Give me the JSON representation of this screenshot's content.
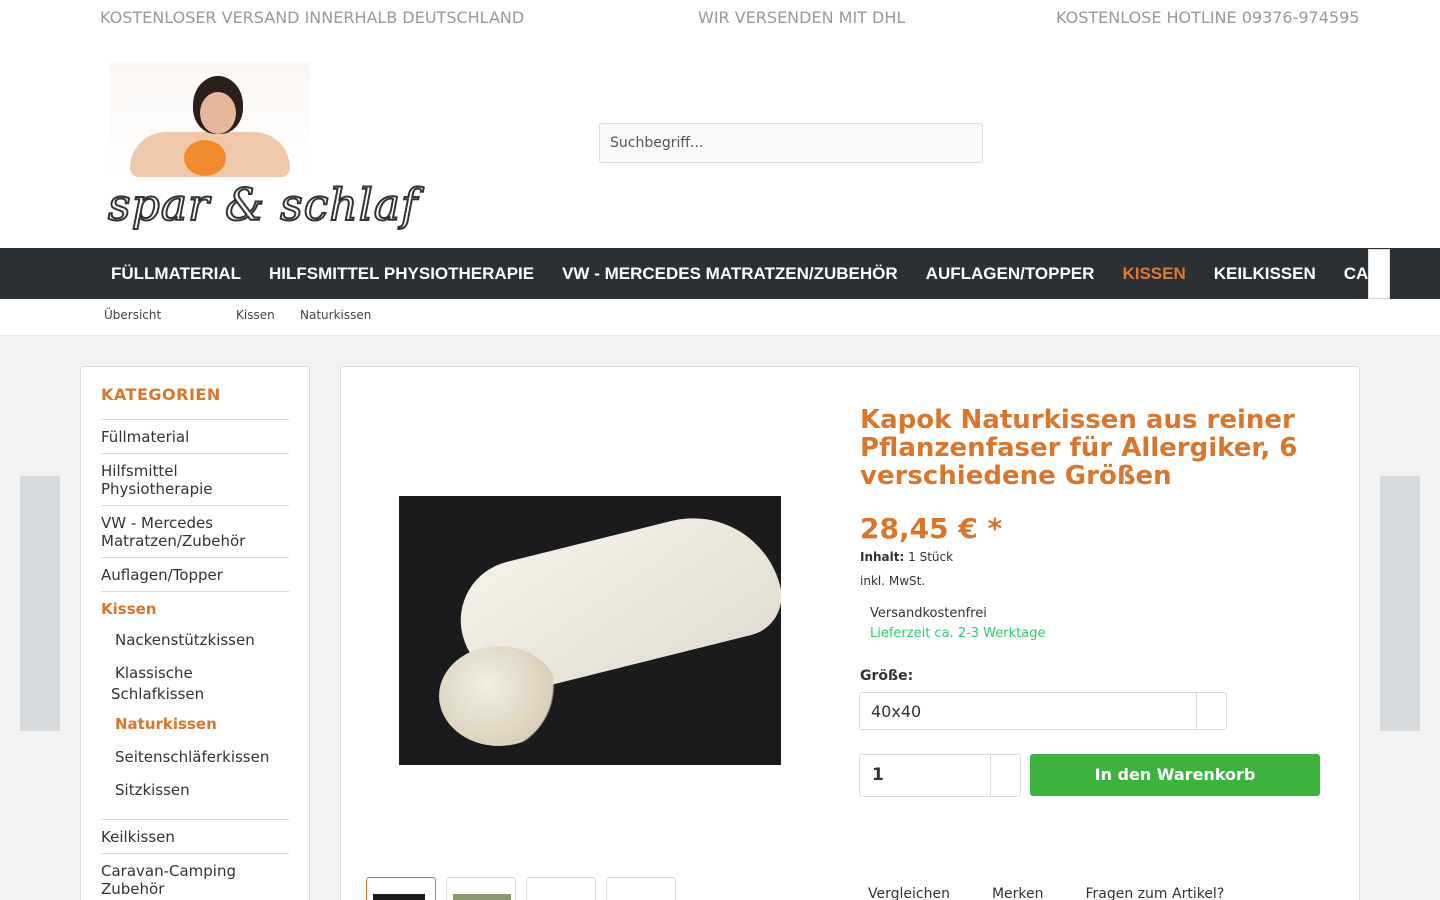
{
  "topbar": {
    "items": [
      {
        "icon": "shipping-icon",
        "glyph": "",
        "text": "KOSTENLOSER VERSAND INNERHALB DEUTSCHLAND"
      },
      {
        "icon": "truck-icon",
        "glyph": "",
        "text": "WIR VERSENDEN MIT DHL"
      },
      {
        "icon": "phone-icon",
        "glyph": "",
        "text": "KOSTENLOSE HOTLINE 09376-974595"
      }
    ]
  },
  "header": {
    "logo_text": "spar & schlaf",
    "search_placeholder": "Suchbegriff...",
    "search_glyph": "",
    "icons": [
      {
        "name": "user-icon",
        "glyph": ""
      },
      {
        "name": "heart-icon",
        "glyph": ""
      },
      {
        "name": "cart-icon",
        "glyph": ""
      }
    ]
  },
  "nav": {
    "home_glyph": "",
    "items": [
      "Füllmaterial",
      "Hilfsmittel Physiotherapie",
      "VW - Mercedes Matratzen/Zubehör",
      "Auflagen/Topper",
      "Kissen",
      "Keilkissen",
      "Caravan-Camping Zubehör"
    ],
    "active": "Kissen",
    "more_glyph": ""
  },
  "breadcrumb": {
    "overview_glyph": "",
    "overview": "Übersicht",
    "home_glyph": "",
    "sep_glyph": "",
    "items": [
      "Kissen",
      "Naturkissen"
    ]
  },
  "side_arrows": {
    "prev": "",
    "next": ""
  },
  "sidebar": {
    "heading": "KATEGORIEN",
    "items": [
      {
        "label": "Füllmaterial"
      },
      {
        "label": "Hilfsmittel Physiotherapie"
      },
      {
        "label": "VW - Mercedes Matratzen/Zubehör"
      },
      {
        "label": "Auflagen/Topper"
      },
      {
        "label": "Kissen"
      },
      {
        "label": "Nackenstützkissen"
      },
      {
        "label": "Klassische Schlafkissen"
      },
      {
        "label": "Naturkissen"
      },
      {
        "label": "Seitenschläferkissen"
      },
      {
        "label": "Sitzkissen"
      },
      {
        "label": "Keilkissen"
      },
      {
        "label": "Caravan-Camping Zubehör"
      }
    ],
    "sub_bullet": ""
  },
  "product": {
    "title": "Kapok Naturkissen aus reiner Pflanzenfaser für Allergiker, 6 verschiedene Größen",
    "price": "28,45 € *",
    "content_label": "Inhalt:",
    "content_value": "1 Stück",
    "tax": "inkl. MwSt.",
    "shipping_glyph": "",
    "shipping": "Versandkostenfrei",
    "delivery_glyph": "",
    "delivery": "Lieferzeit ca. 2-3 Werktage",
    "size_label": "Größe:",
    "size_value": "40x40",
    "select_glyph": "",
    "quantity": "1",
    "cart_label": "In den Warenkorb",
    "cart_glyph": "",
    "actions": [
      {
        "glyph": "",
        "label": "Vergleichen"
      },
      {
        "glyph": "",
        "label": "Merken"
      },
      {
        "glyph": "",
        "label": "Fragen zum Artikel?"
      }
    ]
  },
  "colors": {
    "accent": "#d9762b",
    "nav_bg": "#2b3034",
    "cart_green": "#3cb33e",
    "delivery_green": "#2ecc71"
  }
}
